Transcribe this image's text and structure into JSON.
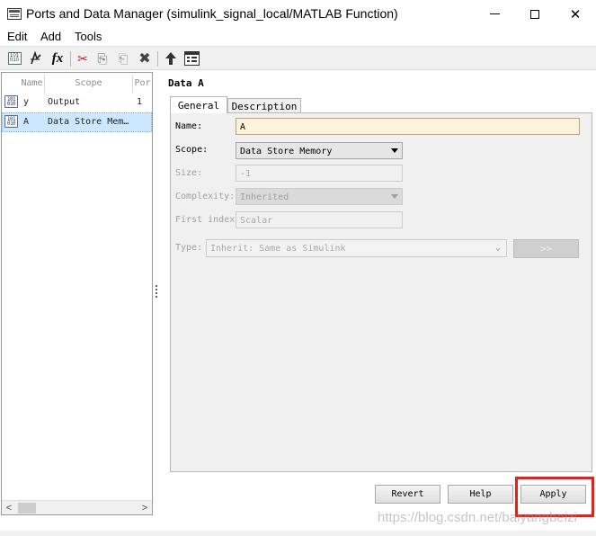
{
  "window": {
    "title": "Ports and Data Manager (simulink_signal_local/MATLAB Function)",
    "minimize_glyph": "",
    "close_glyph": "✕"
  },
  "menu": [
    "Edit",
    "Add",
    "Tools"
  ],
  "toolbar": {
    "icons": [
      "add-data-icon",
      "add-event-icon",
      "add-function-icon",
      "cut-icon",
      "copy-icon",
      "paste-icon",
      "delete-icon",
      "move-up-icon",
      "model-explorer-icon"
    ],
    "function_glyph": "fx",
    "cut_glyph": "✂",
    "copy_glyph": "⎘",
    "paste_glyph": "⎗",
    "delete_glyph": "✖",
    "up_glyph": "🡅"
  },
  "list": {
    "columns": [
      "Name",
      "Scope",
      "Por"
    ],
    "rows": [
      {
        "name": "y",
        "scope": "Output",
        "port": "1",
        "icon_text": "101\n010"
      },
      {
        "name": "A",
        "scope": "Data Store Mem…",
        "port": "",
        "icon_text": "101\n010"
      }
    ],
    "scroll_left": "<",
    "scroll_right": ">"
  },
  "detail": {
    "title": "Data A",
    "tabs": [
      "General",
      "Description"
    ],
    "name_label": "Name:",
    "name_value": "A",
    "scope_label": "Scope:",
    "scope_value": "Data Store Memory",
    "size_label": "Size:",
    "size_value": "-1",
    "complexity_label": "Complexity:",
    "complexity_value": "Inherited",
    "first_index_label": "First index",
    "first_index_value": "Scalar",
    "type_label": "Type:",
    "type_value": "Inherit: Same as Simulink",
    "type_expand": ">>"
  },
  "buttons": {
    "revert": "Revert",
    "help": "Help",
    "apply": "Apply"
  },
  "watermark": "https://blog.csdn.net/baiyangbeizi",
  "colors": {
    "selection": "#cce8ff",
    "name_field": "#fdf3dc",
    "highlight": "#e0241a"
  }
}
